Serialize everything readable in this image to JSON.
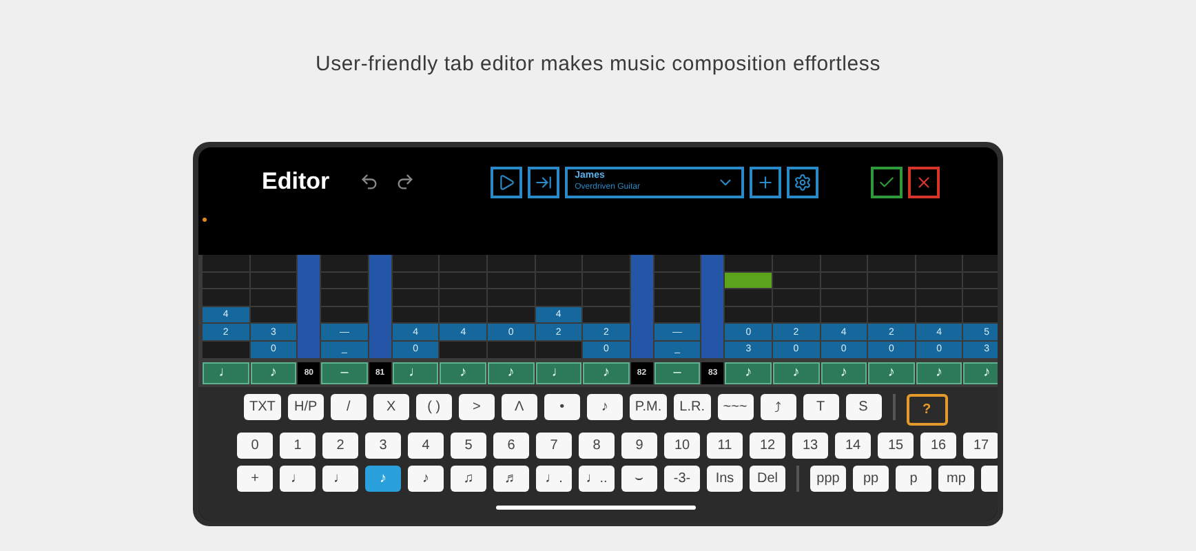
{
  "caption": "User-friendly tab editor makes music composition effortless",
  "toolbar": {
    "title": "Editor",
    "buttons": [
      {
        "kind": "undo"
      },
      {
        "kind": "redo"
      },
      {
        "kind": "play"
      },
      {
        "kind": "next"
      },
      {
        "kind": "track",
        "name": "James",
        "instrument": "Overdriven Guitar"
      },
      {
        "kind": "add"
      },
      {
        "kind": "settings"
      },
      {
        "kind": "confirm"
      },
      {
        "kind": "cancel"
      }
    ]
  },
  "tab": {
    "columns": [
      {
        "kind": "beat",
        "selected": false,
        "strings": [
          {
            "filled": false
          },
          {
            "filled": false
          },
          {
            "filled": false
          },
          {
            "filled": true,
            "fret": "4"
          },
          {
            "filled": true,
            "fret": "2"
          },
          {
            "filled": false
          }
        ],
        "note": "♩"
      },
      {
        "kind": "beat",
        "selected": false,
        "strings": [
          {
            "filled": false
          },
          {
            "filled": false
          },
          {
            "filled": false
          },
          {
            "filled": false
          },
          {
            "filled": true,
            "fret": "3"
          },
          {
            "filled": true,
            "fret": "0"
          }
        ],
        "note": "♪"
      },
      {
        "kind": "bar",
        "label": "80"
      },
      {
        "kind": "beat",
        "selected": false,
        "strings": [
          {
            "filled": false
          },
          {
            "filled": false
          },
          {
            "filled": false
          },
          {
            "filled": false
          },
          {
            "filled": true,
            "fret": "—"
          },
          {
            "filled": true,
            "fret": "_"
          }
        ],
        "note": "–"
      },
      {
        "kind": "bar",
        "label": "81"
      },
      {
        "kind": "beat",
        "selected": false,
        "strings": [
          {
            "filled": false
          },
          {
            "filled": false
          },
          {
            "filled": false
          },
          {
            "filled": false
          },
          {
            "filled": true,
            "fret": "4"
          },
          {
            "filled": true,
            "fret": "0"
          }
        ],
        "note": "♩"
      },
      {
        "kind": "beat",
        "selected": false,
        "strings": [
          {
            "filled": false
          },
          {
            "filled": false
          },
          {
            "filled": false
          },
          {
            "filled": false
          },
          {
            "filled": true,
            "fret": "4"
          },
          {
            "filled": false
          }
        ],
        "note": "♪"
      },
      {
        "kind": "beat",
        "selected": false,
        "strings": [
          {
            "filled": false
          },
          {
            "filled": false
          },
          {
            "filled": false
          },
          {
            "filled": false
          },
          {
            "filled": true,
            "fret": "0"
          },
          {
            "filled": false
          }
        ],
        "note": "♪"
      },
      {
        "kind": "beat",
        "selected": false,
        "strings": [
          {
            "filled": false
          },
          {
            "filled": false
          },
          {
            "filled": false
          },
          {
            "filled": true,
            "fret": "4"
          },
          {
            "filled": true,
            "fret": "2"
          },
          {
            "filled": false
          }
        ],
        "note": "♩"
      },
      {
        "kind": "beat",
        "selected": false,
        "strings": [
          {
            "filled": false
          },
          {
            "filled": false
          },
          {
            "filled": false
          },
          {
            "filled": false
          },
          {
            "filled": true,
            "fret": "2"
          },
          {
            "filled": true,
            "fret": "0"
          }
        ],
        "note": "♪"
      },
      {
        "kind": "bar",
        "label": "82"
      },
      {
        "kind": "beat",
        "selected": false,
        "strings": [
          {
            "filled": false
          },
          {
            "filled": false
          },
          {
            "filled": false
          },
          {
            "filled": false
          },
          {
            "filled": true,
            "fret": "—"
          },
          {
            "filled": true,
            "fret": "_"
          }
        ],
        "note": "–"
      },
      {
        "kind": "bar",
        "label": "83"
      },
      {
        "kind": "beat",
        "selected": true,
        "strings": [
          {
            "filled": false
          },
          {
            "filled": false
          },
          {
            "filled": false
          },
          {
            "filled": false
          },
          {
            "filled": true,
            "fret": "0"
          },
          {
            "filled": true,
            "fret": "3"
          }
        ],
        "note": "♪"
      },
      {
        "kind": "beat",
        "selected": false,
        "strings": [
          {
            "filled": false
          },
          {
            "filled": false
          },
          {
            "filled": false
          },
          {
            "filled": false
          },
          {
            "filled": true,
            "fret": "2"
          },
          {
            "filled": true,
            "fret": "0"
          }
        ],
        "note": "♪"
      },
      {
        "kind": "beat",
        "selected": false,
        "strings": [
          {
            "filled": false
          },
          {
            "filled": false
          },
          {
            "filled": false
          },
          {
            "filled": false
          },
          {
            "filled": true,
            "fret": "4"
          },
          {
            "filled": true,
            "fret": "0"
          }
        ],
        "note": "♪"
      },
      {
        "kind": "beat",
        "selected": false,
        "strings": [
          {
            "filled": false
          },
          {
            "filled": false
          },
          {
            "filled": false
          },
          {
            "filled": false
          },
          {
            "filled": true,
            "fret": "2"
          },
          {
            "filled": true,
            "fret": "0"
          }
        ],
        "note": "♪"
      },
      {
        "kind": "beat",
        "selected": false,
        "strings": [
          {
            "filled": false
          },
          {
            "filled": false
          },
          {
            "filled": false
          },
          {
            "filled": false
          },
          {
            "filled": true,
            "fret": "4"
          },
          {
            "filled": true,
            "fret": "0"
          }
        ],
        "note": "♪"
      },
      {
        "kind": "beat",
        "selected": false,
        "strings": [
          {
            "filled": false
          },
          {
            "filled": false
          },
          {
            "filled": false
          },
          {
            "filled": false
          },
          {
            "filled": true,
            "fret": "5"
          },
          {
            "filled": true,
            "fret": "3"
          }
        ],
        "note": "♪"
      }
    ]
  },
  "keyboard": {
    "rows": [
      {
        "keys": [
          {
            "kind": "key",
            "label": "TXT"
          },
          {
            "kind": "key",
            "label": "H/P"
          },
          {
            "kind": "key",
            "label": "/"
          },
          {
            "kind": "key",
            "label": "X"
          },
          {
            "kind": "key",
            "label": "( )"
          },
          {
            "kind": "key",
            "label": ">"
          },
          {
            "kind": "key",
            "label": "Λ"
          },
          {
            "kind": "key",
            "label": "•"
          },
          {
            "kind": "key",
            "label": "♪"
          },
          {
            "kind": "key",
            "label": "P.M."
          },
          {
            "kind": "key",
            "label": "L.R."
          },
          {
            "kind": "key",
            "label": "~~~"
          },
          {
            "kind": "key",
            "label": "⤴"
          },
          {
            "kind": "key",
            "label": "T"
          },
          {
            "kind": "key",
            "label": "S"
          },
          {
            "kind": "separator"
          },
          {
            "kind": "help",
            "label": "?"
          }
        ]
      },
      {
        "keys": [
          {
            "kind": "key",
            "label": "0"
          },
          {
            "kind": "key",
            "label": "1"
          },
          {
            "kind": "key",
            "label": "2"
          },
          {
            "kind": "key",
            "label": "3"
          },
          {
            "kind": "key",
            "label": "4"
          },
          {
            "kind": "key",
            "label": "5"
          },
          {
            "kind": "key",
            "label": "6"
          },
          {
            "kind": "key",
            "label": "7"
          },
          {
            "kind": "key",
            "label": "8"
          },
          {
            "kind": "key",
            "label": "9"
          },
          {
            "kind": "key",
            "label": "10"
          },
          {
            "kind": "key",
            "label": "11"
          },
          {
            "kind": "key",
            "label": "12"
          },
          {
            "kind": "key",
            "label": "13"
          },
          {
            "kind": "key",
            "label": "14"
          },
          {
            "kind": "key",
            "label": "15"
          },
          {
            "kind": "key",
            "label": "16"
          },
          {
            "kind": "key",
            "label": "17"
          }
        ]
      },
      {
        "keys": [
          {
            "kind": "key",
            "label": "+",
            "selected": false
          },
          {
            "kind": "key",
            "label": "♩",
            "selected": false
          },
          {
            "kind": "key",
            "label": "♩",
            "selected": false
          },
          {
            "kind": "key",
            "label": "♪",
            "selected": true
          },
          {
            "kind": "key",
            "label": "♪",
            "selected": false
          },
          {
            "kind": "key",
            "label": "♫",
            "selected": false
          },
          {
            "kind": "key",
            "label": "♬",
            "selected": false
          },
          {
            "kind": "key",
            "label": "♩.",
            "selected": false
          },
          {
            "kind": "key",
            "label": "♩..",
            "selected": false
          },
          {
            "kind": "key",
            "label": "⌣",
            "selected": false
          },
          {
            "kind": "key",
            "label": "-3-",
            "selected": false
          },
          {
            "kind": "key",
            "label": "Ins",
            "selected": false
          },
          {
            "kind": "key",
            "label": "Del",
            "selected": false
          },
          {
            "kind": "separator"
          },
          {
            "kind": "key",
            "label": "ppp",
            "selected": false
          },
          {
            "kind": "key",
            "label": "pp",
            "selected": false
          },
          {
            "kind": "key",
            "label": "p",
            "selected": false
          },
          {
            "kind": "key",
            "label": "mp",
            "selected": false
          },
          {
            "kind": "partial"
          }
        ]
      }
    ]
  }
}
